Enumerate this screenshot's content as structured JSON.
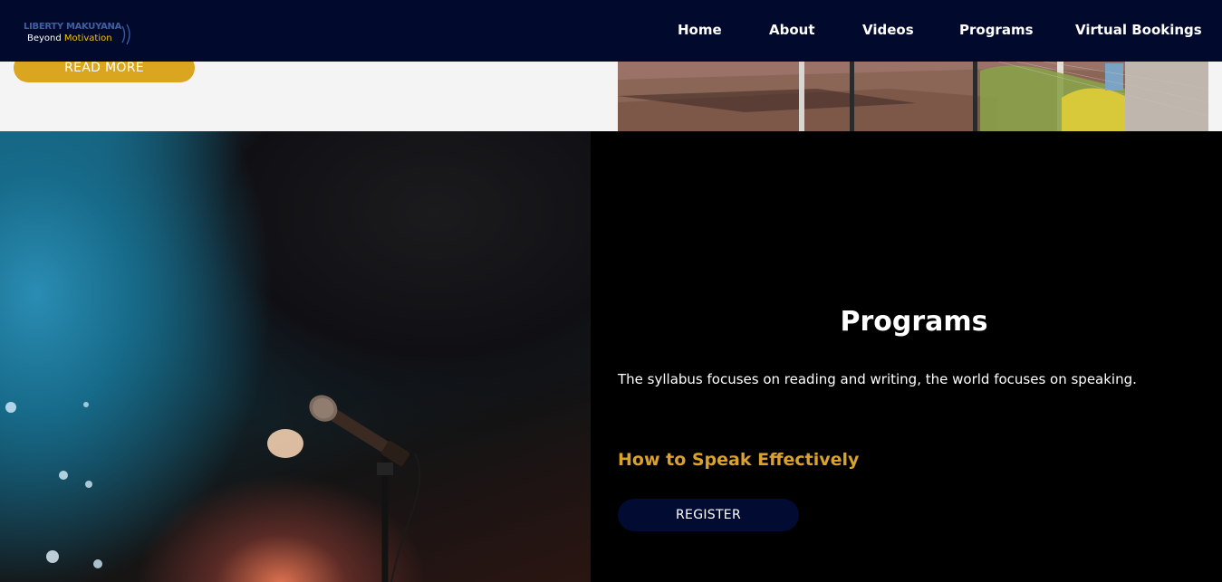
{
  "header": {
    "logo": {
      "line1": "LIBERTY MAKUYANA",
      "line2_prefix": "Beyond",
      "line2_accent": "Motivation"
    },
    "nav": [
      {
        "label": "Home"
      },
      {
        "label": "About"
      },
      {
        "label": "Videos"
      },
      {
        "label": "Programs"
      },
      {
        "label": "Virtual Bookings"
      }
    ]
  },
  "previous_section": {
    "read_more_label": "READ MORE"
  },
  "programs": {
    "title": "Programs",
    "description": "The syllabus focuses on reading and writing, the world focuses on speaking.",
    "course_title": "How to Speak Effectively",
    "register_label": "REGISTER"
  },
  "colors": {
    "header_bg": "#010a2c",
    "accent_gold": "#daa51f",
    "register_bg": "#020c33"
  }
}
